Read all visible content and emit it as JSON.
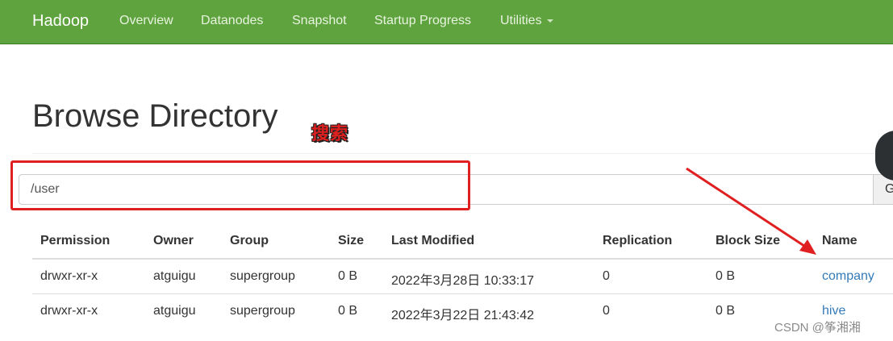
{
  "navbar": {
    "brand": "Hadoop",
    "items": [
      "Overview",
      "Datanodes",
      "Snapshot",
      "Startup Progress",
      "Utilities"
    ]
  },
  "page": {
    "title": "Browse Directory"
  },
  "annotation": {
    "label": "搜索",
    "color": "#e02020"
  },
  "search": {
    "value": "/user",
    "go_label": "Go!"
  },
  "table": {
    "columns": [
      "Permission",
      "Owner",
      "Group",
      "Size",
      "Last Modified",
      "Replication",
      "Block Size",
      "Name"
    ],
    "rows": [
      [
        "drwxr-xr-x",
        "atguigu",
        "supergroup",
        "0 B",
        "2022年3月28日 10:33:17",
        "0",
        "0 B",
        "company"
      ],
      [
        "drwxr-xr-x",
        "atguigu",
        "supergroup",
        "0 B",
        "2022年3月22日 21:43:42",
        "0",
        "0 B",
        "hive"
      ]
    ]
  },
  "watermark": "CSDN @筝湘湘",
  "colors": {
    "navbar": "#5fa33e",
    "link": "#337ab7",
    "annotation": "#e02020"
  }
}
